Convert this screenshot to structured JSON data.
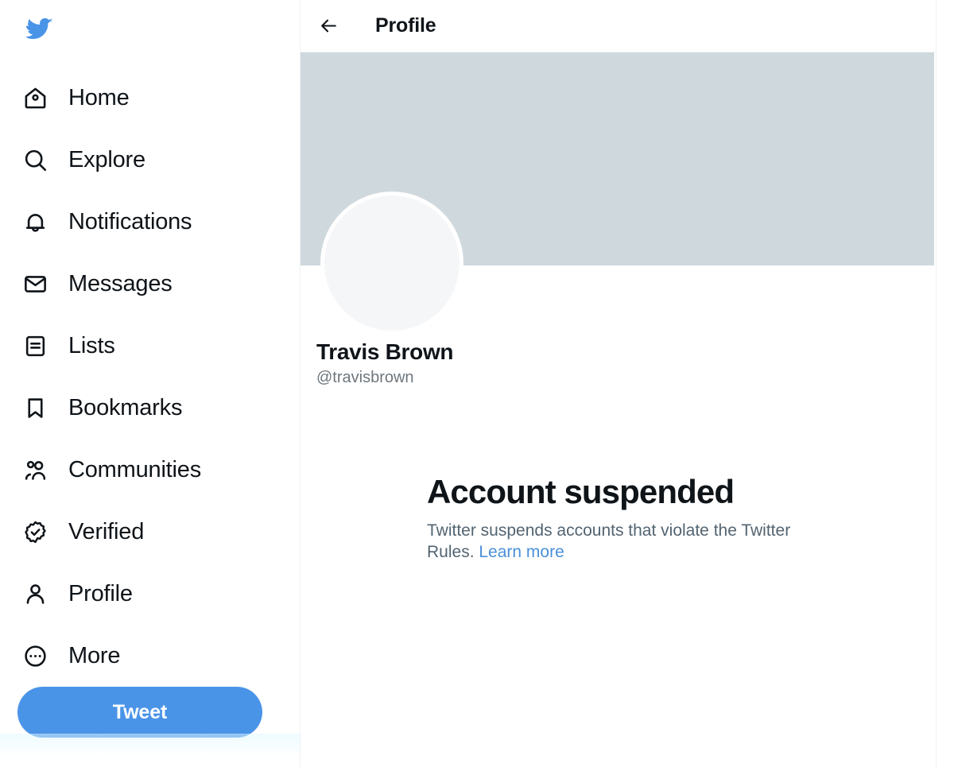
{
  "brand": {
    "logo_icon": "twitter-bird-icon",
    "logo_color": "#4a94e8",
    "accent_color": "#4a94e8",
    "link_color": "#4a90d9"
  },
  "sidebar": {
    "items": [
      {
        "label": "Home",
        "icon": "home-icon"
      },
      {
        "label": "Explore",
        "icon": "search-icon"
      },
      {
        "label": "Notifications",
        "icon": "bell-icon"
      },
      {
        "label": "Messages",
        "icon": "envelope-icon"
      },
      {
        "label": "Lists",
        "icon": "list-icon"
      },
      {
        "label": "Bookmarks",
        "icon": "bookmark-icon"
      },
      {
        "label": "Communities",
        "icon": "people-icon"
      },
      {
        "label": "Verified",
        "icon": "verified-badge-icon"
      },
      {
        "label": "Profile",
        "icon": "person-icon"
      },
      {
        "label": "More",
        "icon": "more-circle-icon"
      }
    ],
    "tweet_button": "Tweet"
  },
  "header": {
    "back_icon": "arrow-left-icon",
    "title": "Profile"
  },
  "profile": {
    "banner_color": "#cfd9dd",
    "avatar_color": "#f4f6f7",
    "display_name": "Travis Brown",
    "handle": "@travisbrown"
  },
  "suspension": {
    "title": "Account suspended",
    "description": "Twitter suspends accounts that violate the Twitter Rules. ",
    "link_label": "Learn more"
  }
}
